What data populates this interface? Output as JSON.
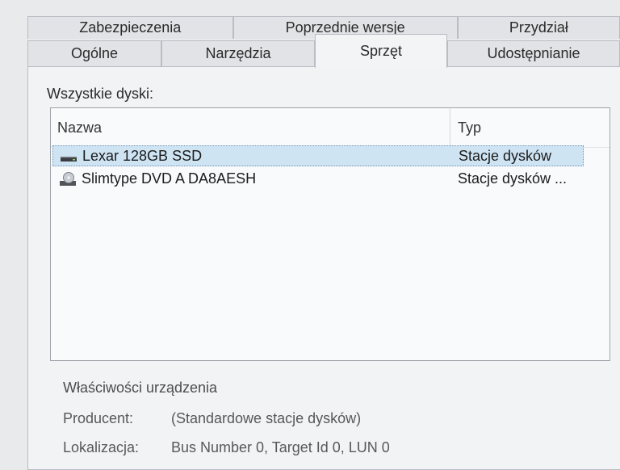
{
  "tabs_row1": [
    "Zabezpieczenia",
    "Poprzednie wersje",
    "Przydział"
  ],
  "tabs_row2": [
    "Ogólne",
    "Narzędzia",
    "Sprzęt",
    "Udostępnianie"
  ],
  "active_tab": "Sprzęt",
  "disks_label": "Wszystkie dyski:",
  "list": {
    "columns": [
      "Nazwa",
      "Typ"
    ],
    "rows": [
      {
        "name": "Lexar 128GB SSD",
        "type": "Stacje dysków",
        "icon": "drive-icon",
        "selected": true
      },
      {
        "name": "Slimtype DVD A  DA8AESH",
        "type": "Stacje dysków ...",
        "icon": "dvd-drive-icon",
        "selected": false
      }
    ]
  },
  "properties": {
    "title": "Właściwości urządzenia",
    "manufacturer_label": "Producent:",
    "manufacturer_value": "(Standardowe stacje dysków)",
    "location_label": "Lokalizacja:",
    "location_value": "Bus Number 0, Target Id 0, LUN 0"
  },
  "colors": {
    "selection": "#cfe4f3",
    "background": "#e9eaec"
  }
}
